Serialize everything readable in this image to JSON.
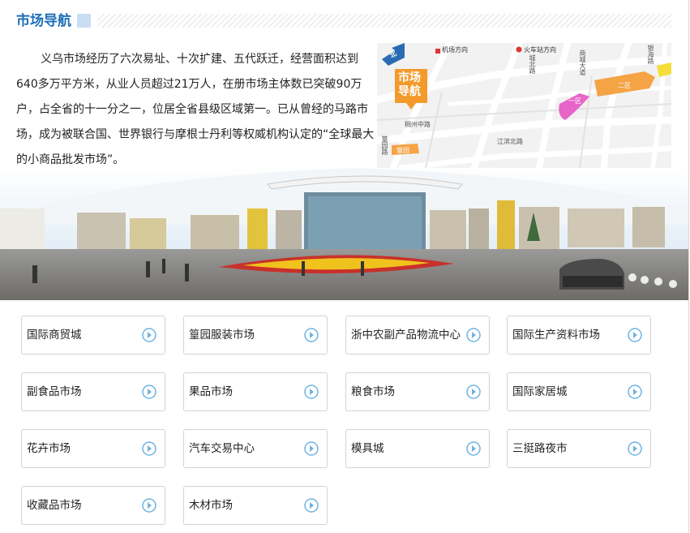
{
  "header": {
    "title": "市场导航"
  },
  "intro": {
    "text": "义乌市场经历了六次易址、十次扩建、五代跃迁，经营面积达到640多万平方米，从业人员超过21万人，在册市场主体数已突破90万户，占全省的十一分之一，位居全省县级区域第一。已从曾经的马路市场，成为被联合国、世界银行与摩根士丹利等权威机构认定的“全球最大的小商品批发市场”。"
  },
  "map": {
    "north": "北",
    "badge_line1": "市场",
    "badge_line2": "导航",
    "labels": {
      "airport": "机场方向",
      "station": "火车站方向",
      "chengbei": "城北路",
      "shangcheng": "商城大道",
      "zone1": "一区",
      "zone2": "二区",
      "choujiang": "稠州中路",
      "jiangdong": "江滨北路",
      "huangyuan": "篁园",
      "huangyuan_road": "篁园路",
      "yinhai": "银海路"
    }
  },
  "markets": [
    {
      "label": "国际商贸城"
    },
    {
      "label": "篁园服装市场"
    },
    {
      "label": "浙中农副产品物流中心"
    },
    {
      "label": "国际生产资料市场"
    },
    {
      "label": "副食品市场"
    },
    {
      "label": "果品市场"
    },
    {
      "label": "粮食市场"
    },
    {
      "label": "国际家居城"
    },
    {
      "label": "花卉市场"
    },
    {
      "label": "汽车交易中心"
    },
    {
      "label": "模具城"
    },
    {
      "label": "三挺路夜市"
    },
    {
      "label": "收藏品市场"
    },
    {
      "label": "木材市场"
    }
  ],
  "colors": {
    "title": "#1e6fb8",
    "arrow": "#6fb3e0",
    "badge": "#f39a2b"
  }
}
